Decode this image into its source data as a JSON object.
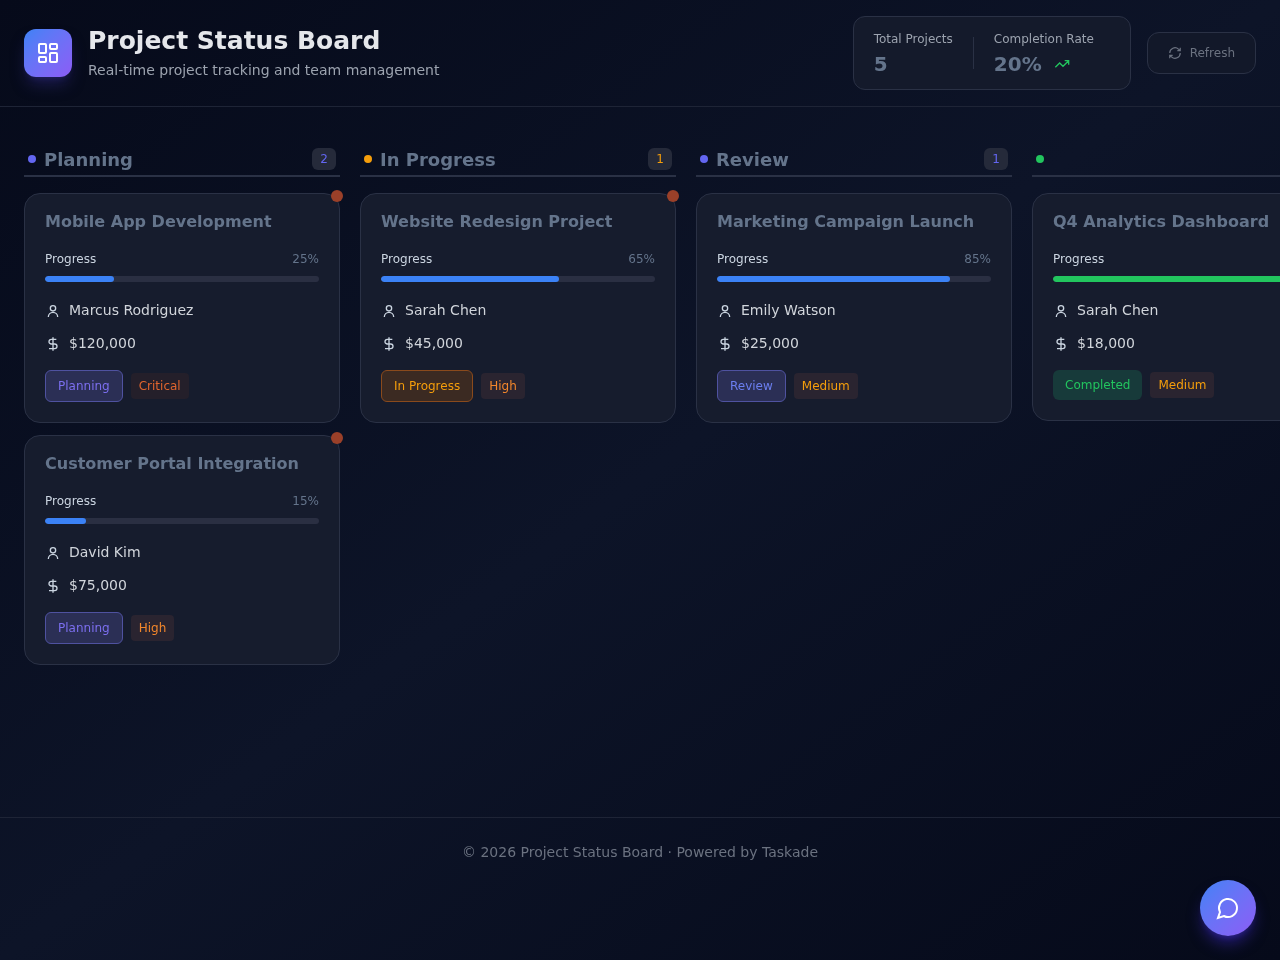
{
  "header": {
    "title": "Project Status Board",
    "subtitle": "Real-time project tracking and team management"
  },
  "stats": [
    {
      "label": "Total Projects",
      "value": "5",
      "trend": false
    },
    {
      "label": "Completion Rate",
      "value": "20%",
      "trend": true
    }
  ],
  "refresh_button": "Refresh",
  "columns": [
    {
      "title": "Planning",
      "count": "2",
      "color": "#6366f1",
      "cards": [
        {
          "title": "Mobile App Development",
          "progress_label": "Progress",
          "percent": "25%",
          "level": 0.25,
          "owner": "Marcus Rodriguez",
          "budget": "$120,000",
          "status": {
            "label": "Planning",
            "kind": "planning"
          },
          "priority": {
            "label": "Critical",
            "kind": "critical"
          },
          "flagged": true
        },
        {
          "title": "Customer Portal Integration",
          "progress_label": "Progress",
          "percent": "15%",
          "level": 0.15,
          "owner": "David Kim",
          "budget": "$75,000",
          "status": {
            "label": "Planning",
            "kind": "planning"
          },
          "priority": {
            "label": "High",
            "kind": "high"
          },
          "flagged": true
        }
      ]
    },
    {
      "title": "In Progress",
      "count": "1",
      "color": "#f59e0b",
      "cards": [
        {
          "title": "Website Redesign Project",
          "progress_label": "Progress",
          "percent": "65%",
          "level": 0.65,
          "owner": "Sarah Chen",
          "budget": "$45,000",
          "status": {
            "label": "In Progress",
            "kind": "progress"
          },
          "priority": {
            "label": "High",
            "kind": "high"
          },
          "flagged": true
        }
      ]
    },
    {
      "title": "Review",
      "count": "1",
      "color": "#6366f1",
      "cards": [
        {
          "title": "Marketing Campaign Launch",
          "progress_label": "Progress",
          "percent": "85%",
          "level": 0.85,
          "owner": "Emily Watson",
          "budget": "$25,000",
          "status": {
            "label": "Review",
            "kind": "review"
          },
          "priority": {
            "label": "Medium",
            "kind": "medium"
          },
          "flagged": false
        }
      ]
    },
    {
      "color": "#22c55e",
      "cards": [
        {
          "title": "Q4 Analytics Dashboard",
          "progress_label": "Progress",
          "level": 1,
          "owner": "Sarah Chen",
          "budget": "$18,000",
          "status": {
            "label": "Completed",
            "kind": "completed"
          },
          "priority": {
            "label": "Medium",
            "kind": "medium"
          },
          "flagged": false
        }
      ]
    }
  ],
  "footer": "© 2026 Project Status Board · Powered by Taskade"
}
